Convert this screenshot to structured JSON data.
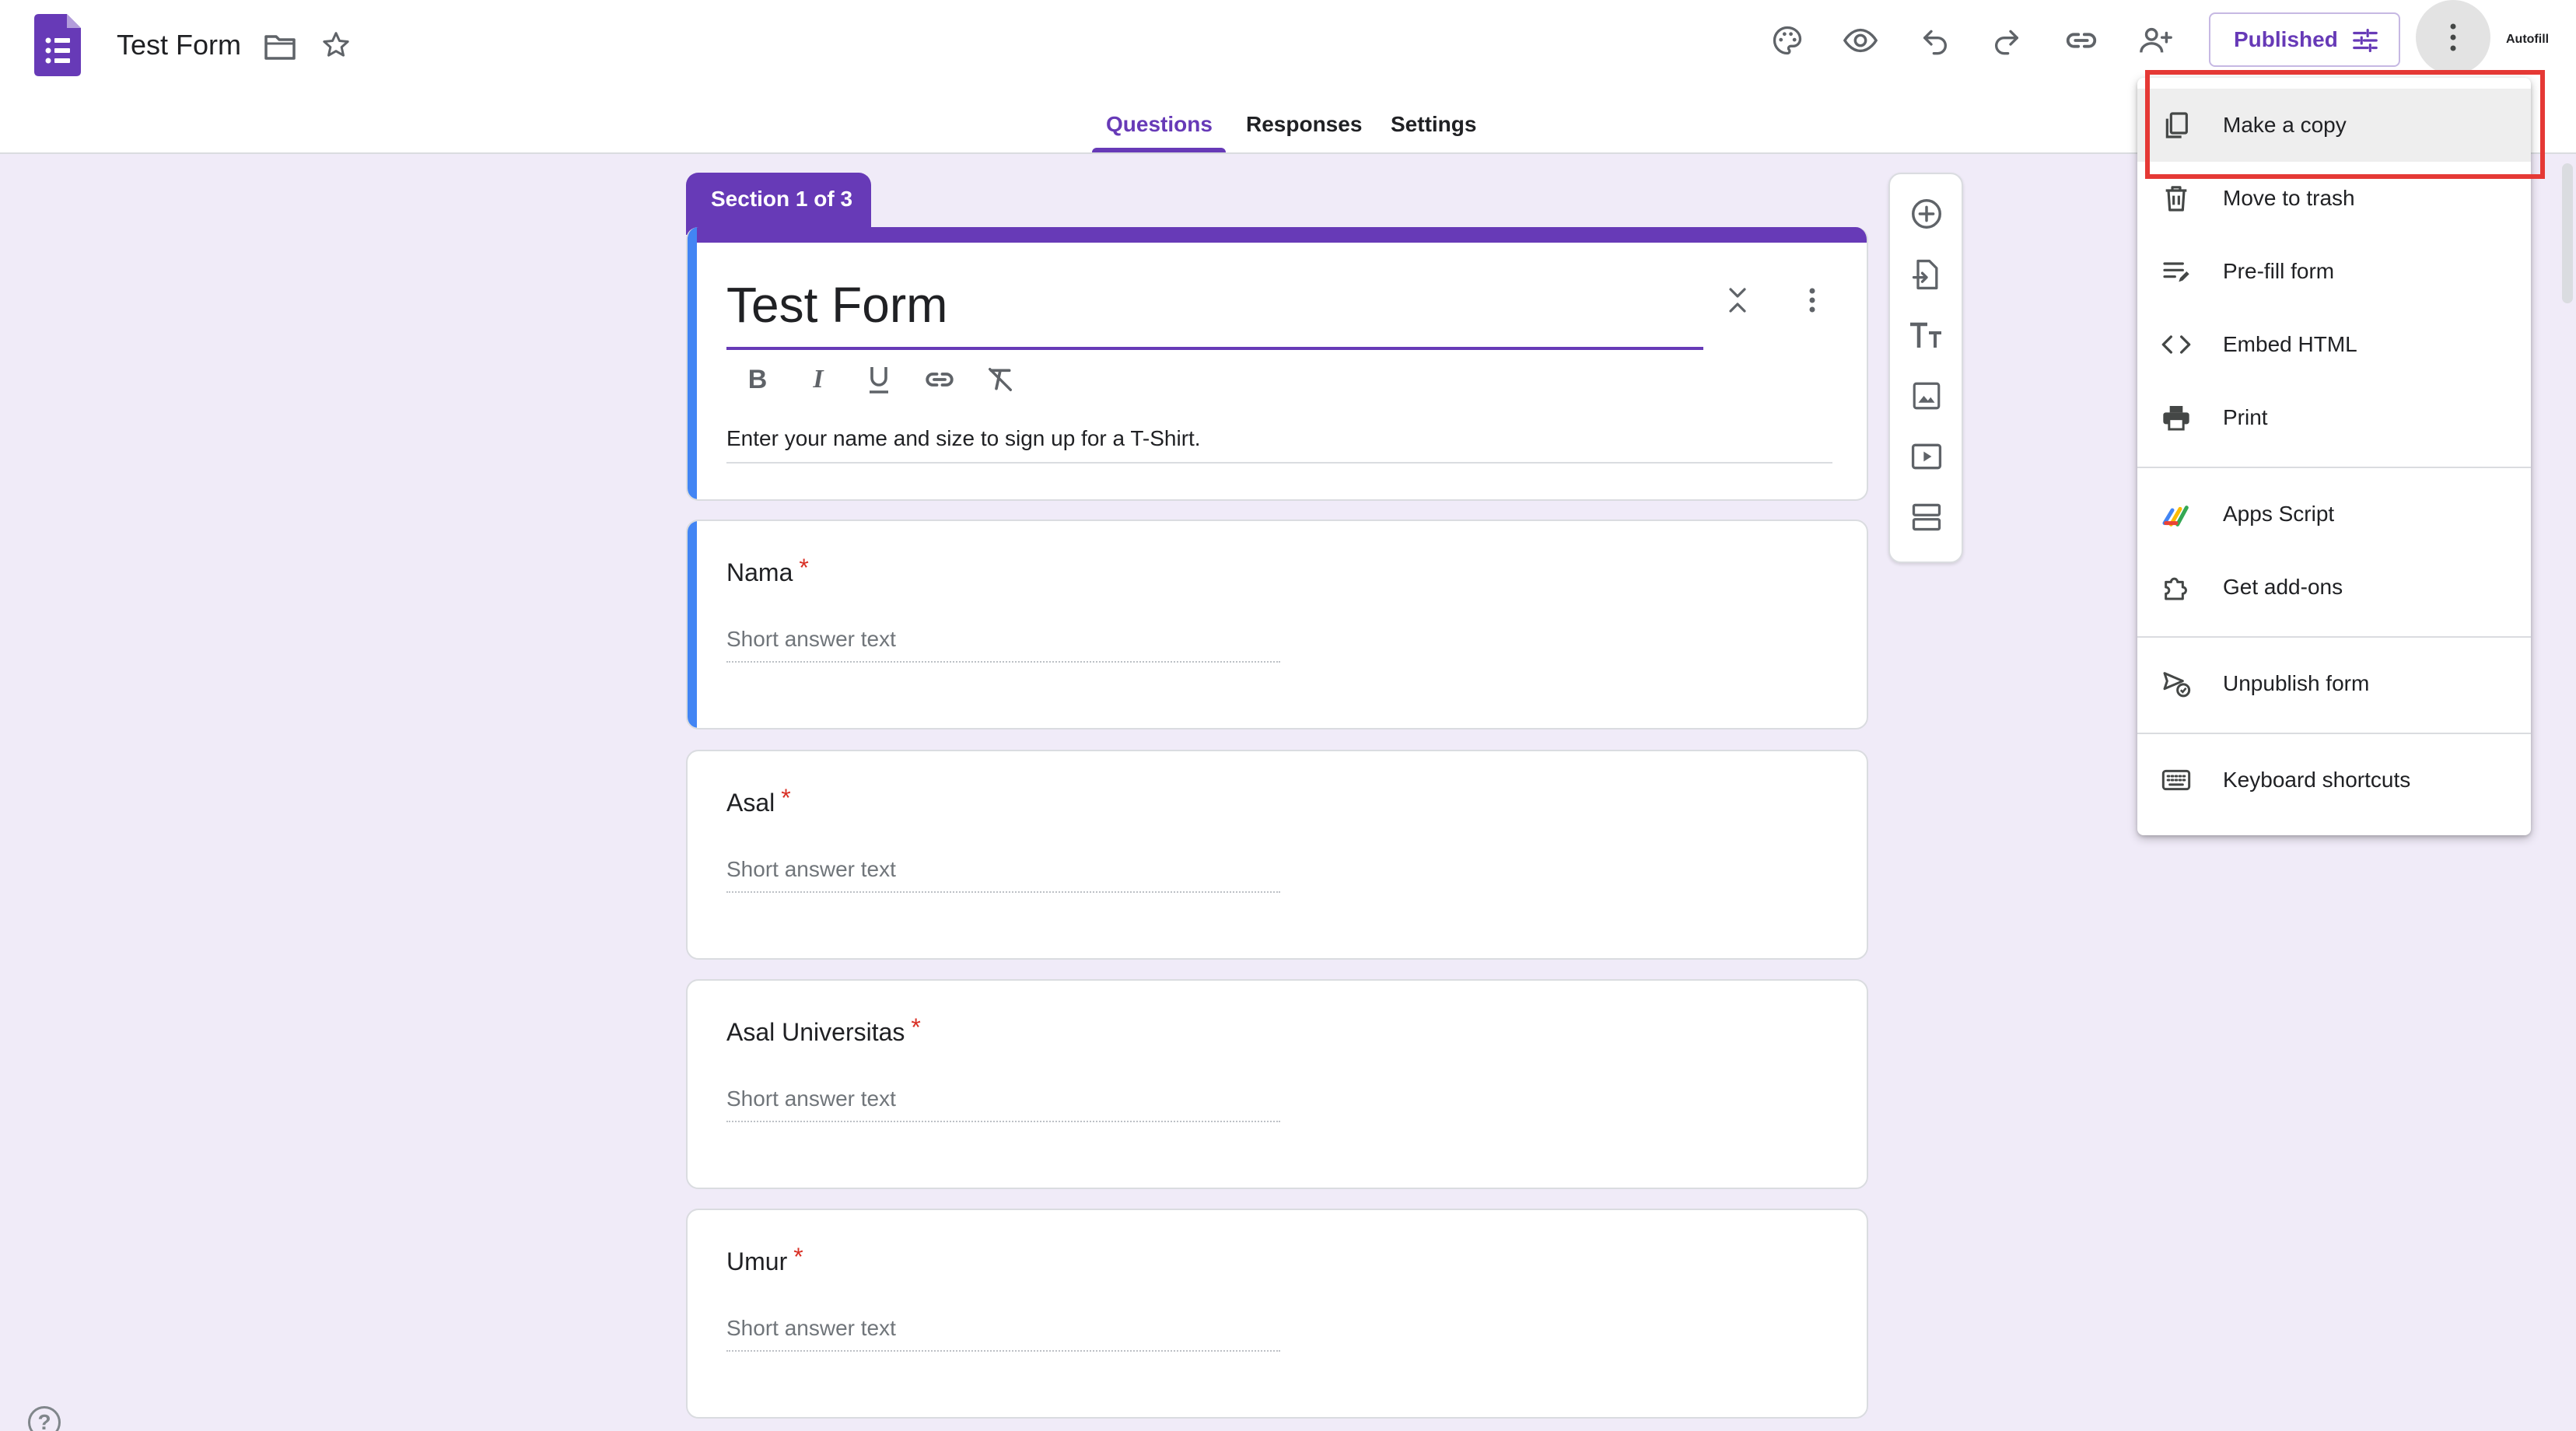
{
  "app": {
    "title": "Test Form"
  },
  "header": {
    "published_label": "Published",
    "autofill_label": "Autofill",
    "tabs": [
      {
        "label": "Questions",
        "active": true
      },
      {
        "label": "Responses",
        "active": false
      },
      {
        "label": "Settings",
        "active": false
      }
    ]
  },
  "section": {
    "label": "Section 1 of 3"
  },
  "form": {
    "title": "Test Form",
    "description": "Enter your name and size to sign up for a T-Shirt."
  },
  "questions": [
    {
      "title": "Nama",
      "required": "*",
      "placeholder": "Short answer text"
    },
    {
      "title": "Asal",
      "required": "*",
      "placeholder": "Short answer text"
    },
    {
      "title": "Asal Universitas",
      "required": "*",
      "placeholder": "Short answer text"
    },
    {
      "title": "Umur",
      "required": "*",
      "placeholder": "Short answer text"
    }
  ],
  "menu": {
    "items": [
      {
        "label": "Make a copy",
        "icon": "copy-icon"
      },
      {
        "label": "Move to trash",
        "icon": "trash-icon"
      },
      {
        "label": "Pre-fill form",
        "icon": "prefill-icon"
      },
      {
        "label": "Embed HTML",
        "icon": "code-icon"
      },
      {
        "label": "Print",
        "icon": "print-icon"
      },
      {
        "label": "Apps Script",
        "icon": "apps-script-icon"
      },
      {
        "label": "Get add-ons",
        "icon": "puzzle-icon"
      },
      {
        "label": "Unpublish form",
        "icon": "unpublish-icon"
      },
      {
        "label": "Keyboard shortcuts",
        "icon": "keyboard-icon"
      }
    ]
  },
  "help": {
    "label": "?"
  },
  "colors": {
    "accent": "#673ab7",
    "background": "#f0ebf8",
    "required": "#d93025",
    "highlight_box": "#e53935"
  }
}
